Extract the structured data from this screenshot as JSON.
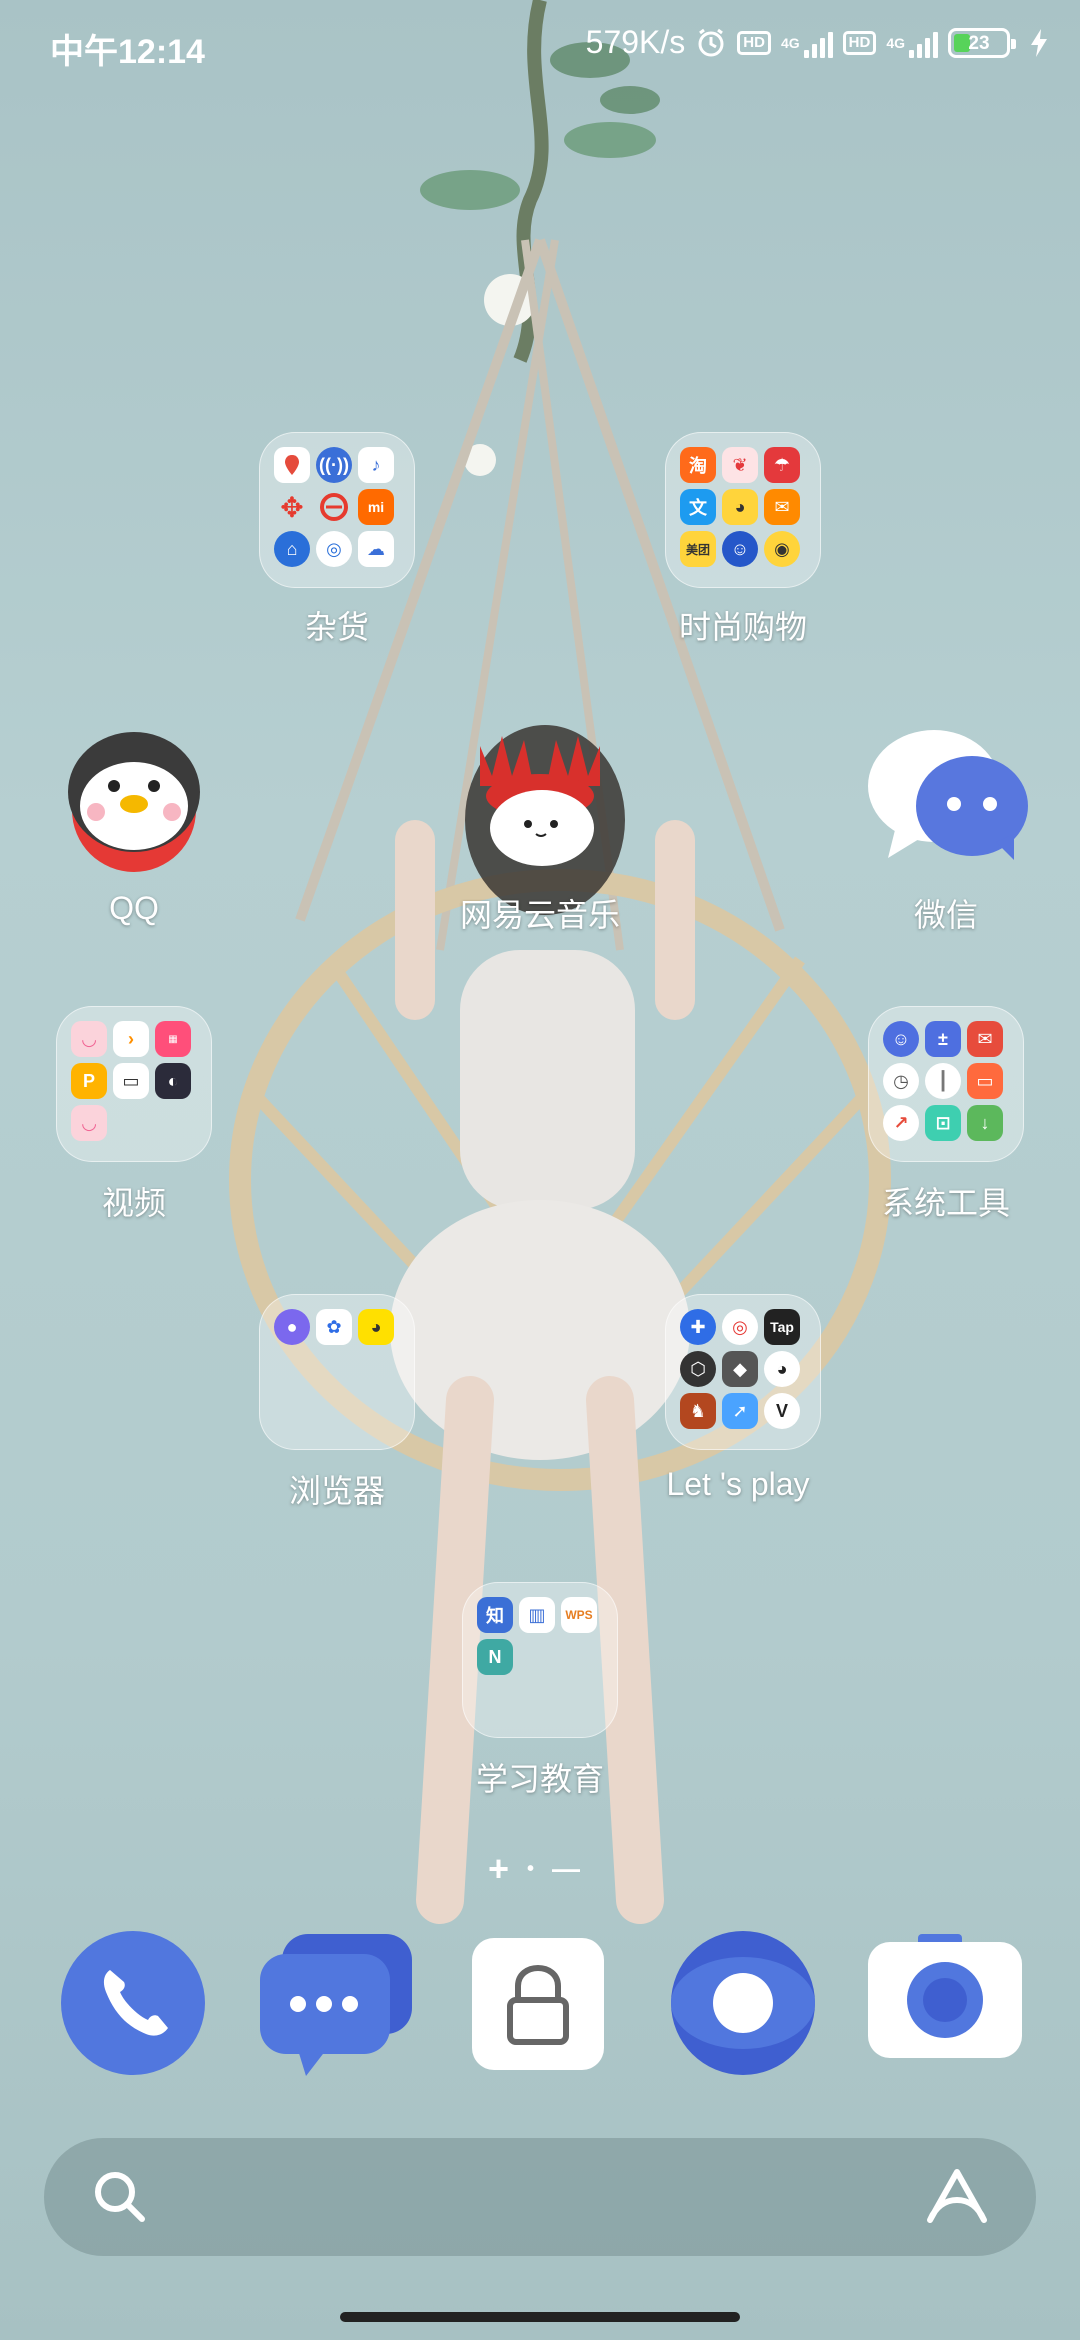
{
  "status_bar": {
    "time": "中午12:14",
    "speed": "579K/s",
    "hd1": "HD",
    "hd2": "HD",
    "net1": "4G",
    "net2": "4G",
    "battery": "23"
  },
  "folders": [
    {
      "label": "杂货"
    },
    {
      "label": "时尚购物"
    },
    {
      "label": "视频"
    },
    {
      "label": "系统工具"
    },
    {
      "label": "浏览器"
    },
    {
      "label": "Let 's  play"
    },
    {
      "label": "学习教育"
    }
  ],
  "apps": {
    "qq": "QQ",
    "netease": "网易云音乐",
    "wechat": "微信"
  },
  "mini_text": {
    "zhi": "知",
    "n": "N",
    "tap": "Tap",
    "taobao": "淘",
    "wen": "文",
    "mi": "mi"
  },
  "pager": {
    "plus": "+",
    "dot": "•",
    "dash": "—"
  },
  "colors": {
    "wallpaper": "#b6cfd1",
    "dock_blue": "#5177de"
  }
}
